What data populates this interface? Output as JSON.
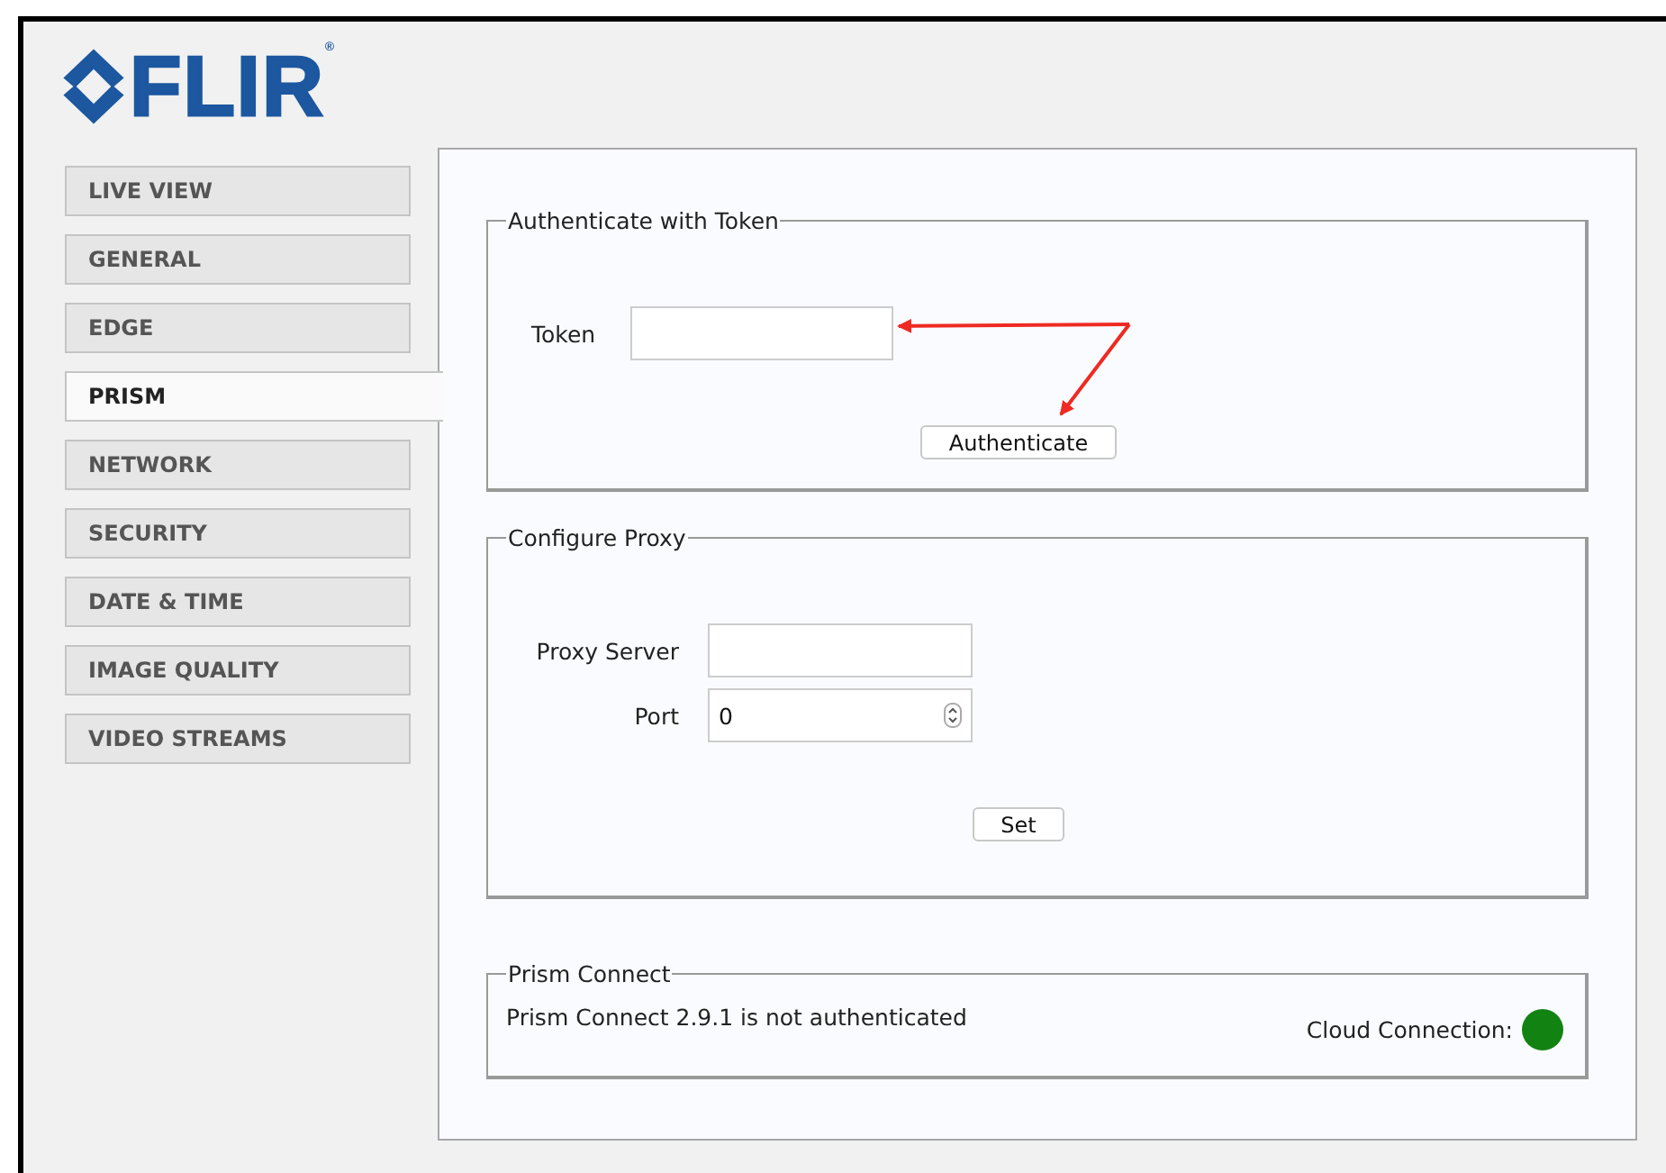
{
  "logo": {
    "text": "FLIR",
    "mark": "®"
  },
  "sidebar": {
    "items": [
      {
        "label": "LIVE VIEW",
        "selected": false
      },
      {
        "label": "GENERAL",
        "selected": false
      },
      {
        "label": "EDGE",
        "selected": false
      },
      {
        "label": "PRISM",
        "selected": true
      },
      {
        "label": "NETWORK",
        "selected": false
      },
      {
        "label": "SECURITY",
        "selected": false
      },
      {
        "label": "DATE & TIME",
        "selected": false
      },
      {
        "label": "IMAGE QUALITY",
        "selected": false
      },
      {
        "label": "VIDEO STREAMS",
        "selected": false
      }
    ]
  },
  "token_section": {
    "title": "Authenticate with Token",
    "field_label": "Token",
    "button": "Authenticate"
  },
  "proxy_section": {
    "title": "Configure Proxy",
    "server_label": "Proxy Server",
    "port_label": "Port",
    "port_value": "0",
    "button": "Set"
  },
  "prism_section": {
    "title": "Prism Connect",
    "status": "Prism Connect 2.9.1 is not authenticated",
    "cloud_label": "Cloud Connection:",
    "indicator": {
      "color": "#128312"
    }
  }
}
